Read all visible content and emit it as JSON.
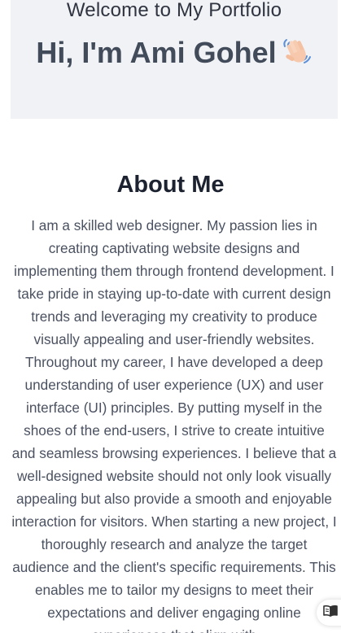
{
  "hero": {
    "subtitle": "Welcome to My Portfolio",
    "title": "Hi, I'm Ami Gohel",
    "emoji_icon": "waving-hand-icon",
    "background": "#f1f2f5"
  },
  "about": {
    "heading": "About Me",
    "paragraph": "I am a skilled web designer. My passion lies in creating captivating website designs and implementing them through frontend development. I take pride in staying up-to-date with current design trends and leveraging my creativity to produce visually appealing and user-friendly websites. Throughout my career, I have developed a deep understanding of user experience (UX) and user interface (UI) principles. By putting myself in the shoes of the end-users, I strive to create intuitive and seamless browsing experiences. I believe that a well-designed website should not only look visually appealing but also provide a smooth and enjoyable interaction for visitors. When starting a new project, I thoroughly research and analyze the target audience and the client's specific requirements. This enables me to tailor my designs to meet their expectations and deliver engaging online experiences that align with"
  },
  "reader_button": {
    "icon": "reader-mode-icon"
  }
}
